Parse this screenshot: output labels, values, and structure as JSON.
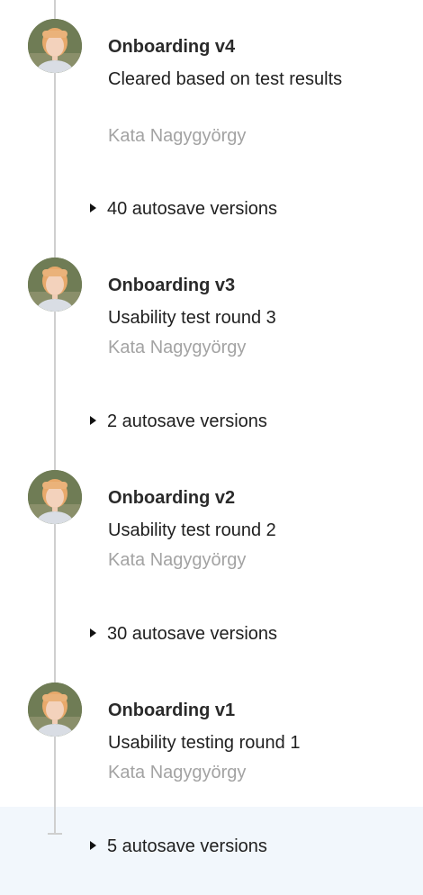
{
  "versions": [
    {
      "title": "Onboarding v4",
      "description": "Cleared based on test results",
      "author": "Kata Nagygyörgy",
      "autosave_label": "40 autosave versions"
    },
    {
      "title": "Onboarding v3",
      "description": "Usability test round 3",
      "author": "Kata Nagygyörgy",
      "autosave_label": "2 autosave versions"
    },
    {
      "title": "Onboarding v2",
      "description": "Usability test round 2",
      "author": "Kata Nagygyörgy",
      "autosave_label": "30 autosave versions"
    },
    {
      "title": "Onboarding v1",
      "description": "Usability testing round 1",
      "author": "Kata Nagygyörgy",
      "autosave_label": "5 autosave versions"
    }
  ],
  "icons": {
    "avatar": "user-avatar-photo",
    "expand": "caret-right-icon"
  },
  "colors": {
    "timeline": "#cfcfcf",
    "author_text": "#a3a3a3",
    "selected_row_bg": "#f2f7fc"
  }
}
